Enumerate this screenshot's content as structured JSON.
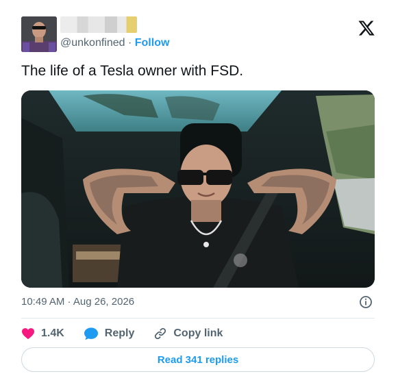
{
  "author": {
    "handle": "@unkonfined",
    "separator": " · ",
    "follow_label": "Follow"
  },
  "tweet": {
    "text": "The life of a Tesla owner with FSD.",
    "timestamp": "10:49 AM · Aug 26, 2026"
  },
  "actions": {
    "likes": "1.4K",
    "reply_label": "Reply",
    "copy_link_label": "Copy link"
  },
  "read_replies_label": "Read 341 replies",
  "icons": {
    "logo": "x-logo-icon",
    "info": "info-icon",
    "like": "heart-icon",
    "reply": "speech-bubble-icon",
    "copy_link": "link-icon"
  },
  "colors": {
    "accent": "#1d9bf0",
    "like": "#f91880",
    "muted_text": "#536471",
    "text": "#0f1419"
  }
}
